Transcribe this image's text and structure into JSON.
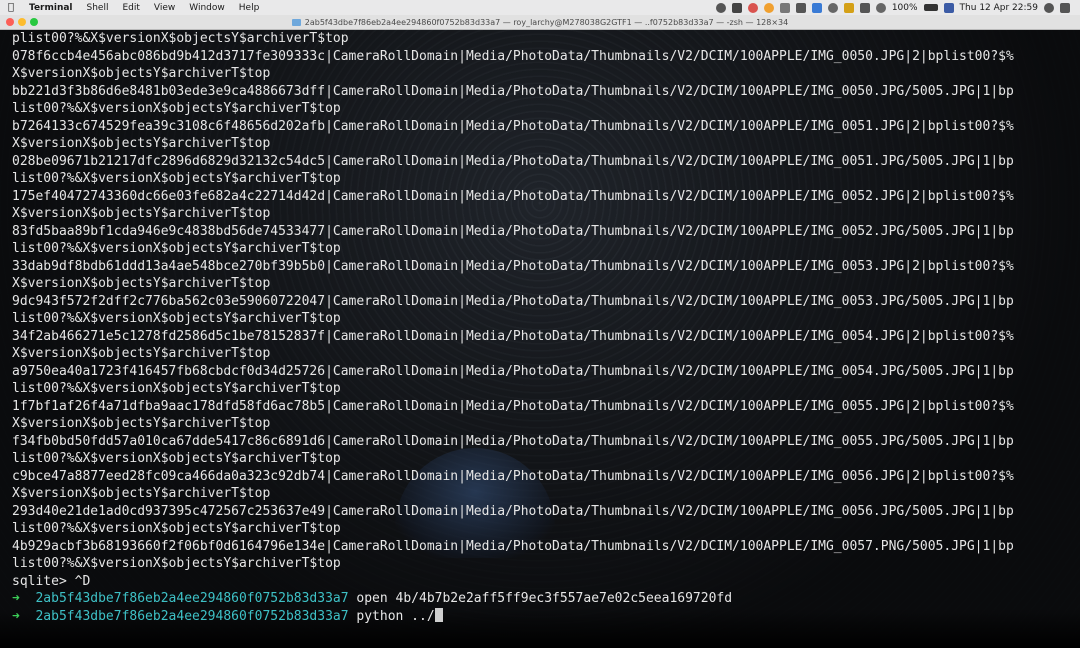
{
  "menubar": {
    "app_name": "Terminal",
    "items": [
      "Shell",
      "Edit",
      "View",
      "Window",
      "Help"
    ],
    "battery": "100%",
    "datetime": "Thu 12 Apr  22:59"
  },
  "window": {
    "title": "2ab5f43dbe7f86eb2a4ee294860f0752b83d33a7 — roy_larchy@M278038G2GTF1 — ..f0752b83d33a7 — -zsh — 128×34"
  },
  "terminal": {
    "lines": [
      "plist00?%&X$versionX$objectsY$archiverT$top",
      "078f6ccb4e456abc086bd9b412d3717fe309333c|CameraRollDomain|Media/PhotoData/Thumbnails/V2/DCIM/100APPLE/IMG_0050.JPG|2|bplist00?$%",
      "X$versionX$objectsY$archiverT$top",
      "bb221d3f3b86d6e8481b03ede3e9ca4886673dff|CameraRollDomain|Media/PhotoData/Thumbnails/V2/DCIM/100APPLE/IMG_0050.JPG/5005.JPG|1|bp",
      "list00?%&X$versionX$objectsY$archiverT$top",
      "b7264133c674529fea39c3108c6f48656d202afb|CameraRollDomain|Media/PhotoData/Thumbnails/V2/DCIM/100APPLE/IMG_0051.JPG|2|bplist00?$%",
      "X$versionX$objectsY$archiverT$top",
      "028be09671b21217dfc2896d6829d32132c54dc5|CameraRollDomain|Media/PhotoData/Thumbnails/V2/DCIM/100APPLE/IMG_0051.JPG/5005.JPG|1|bp",
      "list00?%&X$versionX$objectsY$archiverT$top",
      "175ef40472743360dc66e03fe682a4c22714d42d|CameraRollDomain|Media/PhotoData/Thumbnails/V2/DCIM/100APPLE/IMG_0052.JPG|2|bplist00?$%",
      "X$versionX$objectsY$archiverT$top",
      "83fd5baa89bf1cda946e9c4838bd56de74533477|CameraRollDomain|Media/PhotoData/Thumbnails/V2/DCIM/100APPLE/IMG_0052.JPG/5005.JPG|1|bp",
      "list00?%&X$versionX$objectsY$archiverT$top",
      "33dab9df8bdb61ddd13a4ae548bce270bf39b5b0|CameraRollDomain|Media/PhotoData/Thumbnails/V2/DCIM/100APPLE/IMG_0053.JPG|2|bplist00?$%",
      "X$versionX$objectsY$archiverT$top",
      "9dc943f572f2dff2c776ba562c03e59060722047|CameraRollDomain|Media/PhotoData/Thumbnails/V2/DCIM/100APPLE/IMG_0053.JPG/5005.JPG|1|bp",
      "list00?%&X$versionX$objectsY$archiverT$top",
      "34f2ab466271e5c1278fd2586d5c1be78152837f|CameraRollDomain|Media/PhotoData/Thumbnails/V2/DCIM/100APPLE/IMG_0054.JPG|2|bplist00?$%",
      "X$versionX$objectsY$archiverT$top",
      "a9750ea40a1723f416457fb68cbdcf0d34d25726|CameraRollDomain|Media/PhotoData/Thumbnails/V2/DCIM/100APPLE/IMG_0054.JPG/5005.JPG|1|bp",
      "list00?%&X$versionX$objectsY$archiverT$top",
      "1f7bf1af26f4a71dfba9aac178dfd58fd6ac78b5|CameraRollDomain|Media/PhotoData/Thumbnails/V2/DCIM/100APPLE/IMG_0055.JPG|2|bplist00?$%",
      "X$versionX$objectsY$archiverT$top",
      "f34fb0bd50fdd57a010ca67dde5417c86c6891d6|CameraRollDomain|Media/PhotoData/Thumbnails/V2/DCIM/100APPLE/IMG_0055.JPG/5005.JPG|1|bp",
      "list00?%&X$versionX$objectsY$archiverT$top",
      "c9bce47a8877eed28fc09ca466da0a323c92db74|CameraRollDomain|Media/PhotoData/Thumbnails/V2/DCIM/100APPLE/IMG_0056.JPG|2|bplist00?$%",
      "X$versionX$objectsY$archiverT$top",
      "293d40e21de1ad0cd937395c472567c253637e49|CameraRollDomain|Media/PhotoData/Thumbnails/V2/DCIM/100APPLE/IMG_0056.JPG/5005.JPG|1|bp",
      "list00?%&X$versionX$objectsY$archiverT$top",
      "4b929acbf3b68193660f2f06bf0d6164796e134e|CameraRollDomain|Media/PhotoData/Thumbnails/V2/DCIM/100APPLE/IMG_0057.PNG/5005.JPG|1|bp",
      "list00?%&X$versionX$objectsY$archiverT$top",
      "sqlite> ^D"
    ],
    "prompts": [
      {
        "arrow": "➜",
        "dir": "2ab5f43dbe7f86eb2a4ee294860f0752b83d33a7",
        "command": "open 4b/4b7b2e2aff5ff9ec3f557ae7e02c5eea169720fd"
      },
      {
        "arrow": "➜",
        "dir": "2ab5f43dbe7f86eb2a4ee294860f0752b83d33a7",
        "command": "python ../"
      }
    ],
    "colors": {
      "arrow": "#3ccf58",
      "dir": "#3ec1c6",
      "text": "#e6e6e6"
    }
  }
}
